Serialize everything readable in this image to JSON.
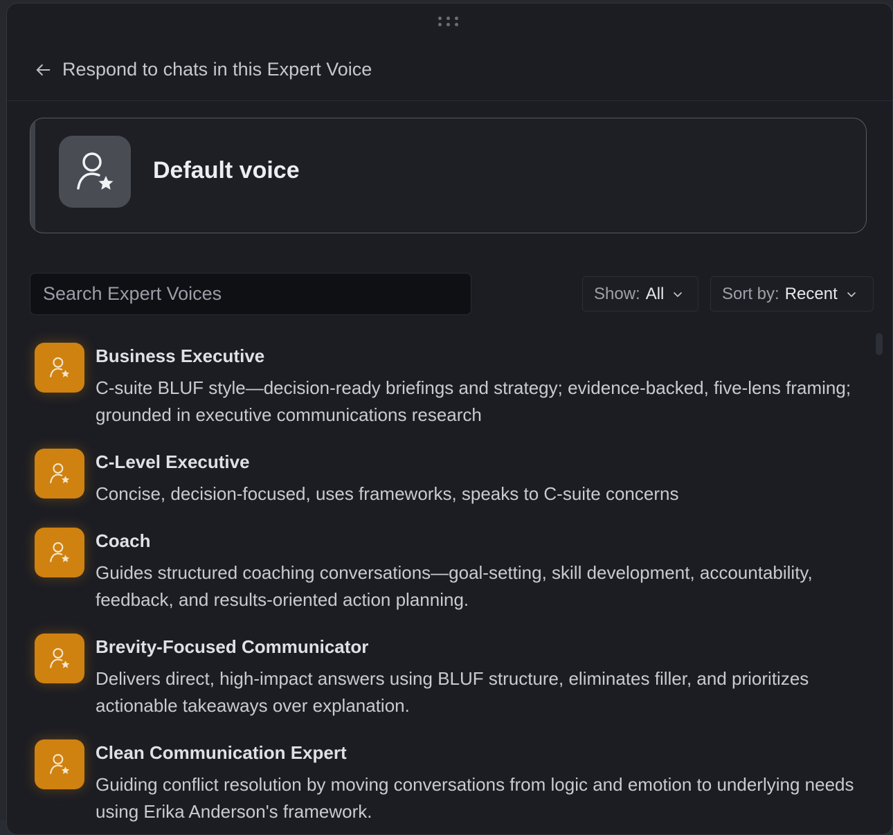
{
  "header": {
    "back_icon": "arrow-left-icon",
    "title": "Respond to chats in this Expert Voice"
  },
  "default_voice": {
    "icon": "user-star-icon",
    "title": "Default voice"
  },
  "search": {
    "placeholder": "Search Expert Voices",
    "value": ""
  },
  "filters": {
    "show_label": "Show:",
    "show_value": "All",
    "sort_label": "Sort by:",
    "sort_value": "Recent"
  },
  "colors": {
    "accent_orange": "#cf8210",
    "panel_bg": "#1c1d23"
  },
  "voices": [
    {
      "title": "Business Executive",
      "description": "C-suite BLUF style—decision-ready briefings and strategy; evidence-backed, five-lens framing; grounded in executive communications research"
    },
    {
      "title": "C-Level Executive",
      "description": "Concise, decision-focused, uses frameworks, speaks to C-suite concerns"
    },
    {
      "title": "Coach",
      "description": "Guides structured coaching conversations—goal-setting, skill development, accountability, feedback, and results-oriented action planning."
    },
    {
      "title": "Brevity-Focused Communicator",
      "description": "Delivers direct, high-impact answers using BLUF structure, eliminates filler, and prioritizes actionable takeaways over explanation."
    },
    {
      "title": "Clean Communication Expert",
      "description": "Guiding conflict resolution by moving conversations from logic and emotion to underlying needs using Erika Anderson's framework."
    }
  ]
}
